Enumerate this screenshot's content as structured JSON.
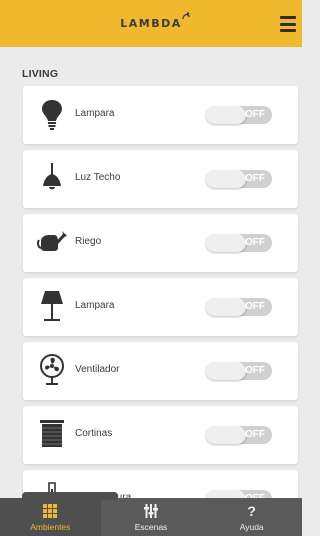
{
  "app": {
    "logo_text": "LAMBDA"
  },
  "section": {
    "title": "LIVING"
  },
  "devices": [
    {
      "label": "Lampara",
      "icon": "bulb-icon",
      "state": "OFF"
    },
    {
      "label": "Luz Techo",
      "icon": "ceiling-light-icon",
      "state": "OFF"
    },
    {
      "label": "Riego",
      "icon": "watering-can-icon",
      "state": "OFF"
    },
    {
      "label": "Lampara",
      "icon": "floor-lamp-icon",
      "state": "OFF"
    },
    {
      "label": "Ventilador",
      "icon": "fan-icon",
      "state": "OFF"
    },
    {
      "label": "Cortinas",
      "icon": "blinds-icon",
      "state": "OFF"
    },
    {
      "label": "Temperatura",
      "icon": "thermometer-icon",
      "state": "OFF"
    }
  ],
  "tabs": [
    {
      "label": "Ambientes",
      "icon": "grid-icon",
      "active": true
    },
    {
      "label": "Escenas",
      "icon": "sliders-icon",
      "active": false
    },
    {
      "label": "Ayuda",
      "icon": "help-icon",
      "active": false
    }
  ],
  "colors": {
    "accent": "#f0b92d",
    "bottom_bar": "#5a5a5a",
    "toggle_off": "#d0d0d0"
  }
}
